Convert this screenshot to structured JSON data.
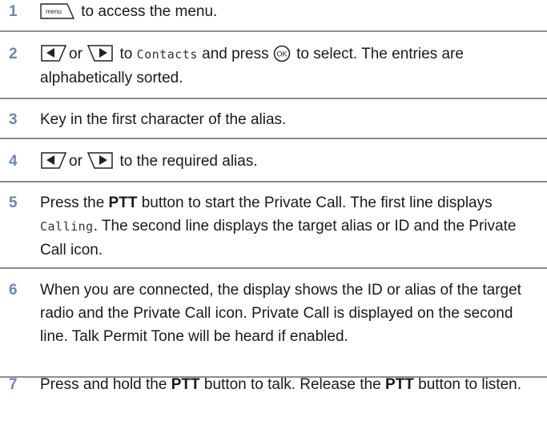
{
  "steps": [
    {
      "number": "1",
      "segments": [
        "to access the menu."
      ],
      "keys": [
        "menu-key"
      ]
    },
    {
      "number": "2",
      "segments": [
        "or",
        "to",
        "Contacts",
        "and press",
        "to select. The entries are alphabetically sorted."
      ],
      "keys": [
        "left-arrow-key",
        "right-arrow-key",
        "ok-key"
      ]
    },
    {
      "number": "3",
      "segments": [
        "Key in the first character of the alias."
      ],
      "keys": []
    },
    {
      "number": "4",
      "segments": [
        "or",
        "to the required alias."
      ],
      "keys": [
        "left-arrow-key",
        "right-arrow-key"
      ]
    },
    {
      "number": "5",
      "segments": [
        "Press the",
        "PTT",
        "button to start the Private Call. The first line displays",
        "Calling",
        ". The second line displays the target alias or ID and the Private Call icon."
      ],
      "keys": []
    },
    {
      "number": "6",
      "segments": [
        "When you are connected, the display shows the ID or alias of the target radio and the Private Call icon. Private Call is displayed on the second line. Talk Permit Tone will be heard if enabled."
      ],
      "keys": []
    },
    {
      "number": "7",
      "segments": [
        "Press and hold the",
        "PTT",
        "button to talk. Release the",
        "PTT",
        "button to listen."
      ],
      "keys": []
    }
  ],
  "icons": {
    "menu_key_label": "menu",
    "ok_key_label": "OK"
  },
  "colors": {
    "step_number": "#6d86b3",
    "separator": "#8d8d8d",
    "text": "#1a1a1a"
  }
}
